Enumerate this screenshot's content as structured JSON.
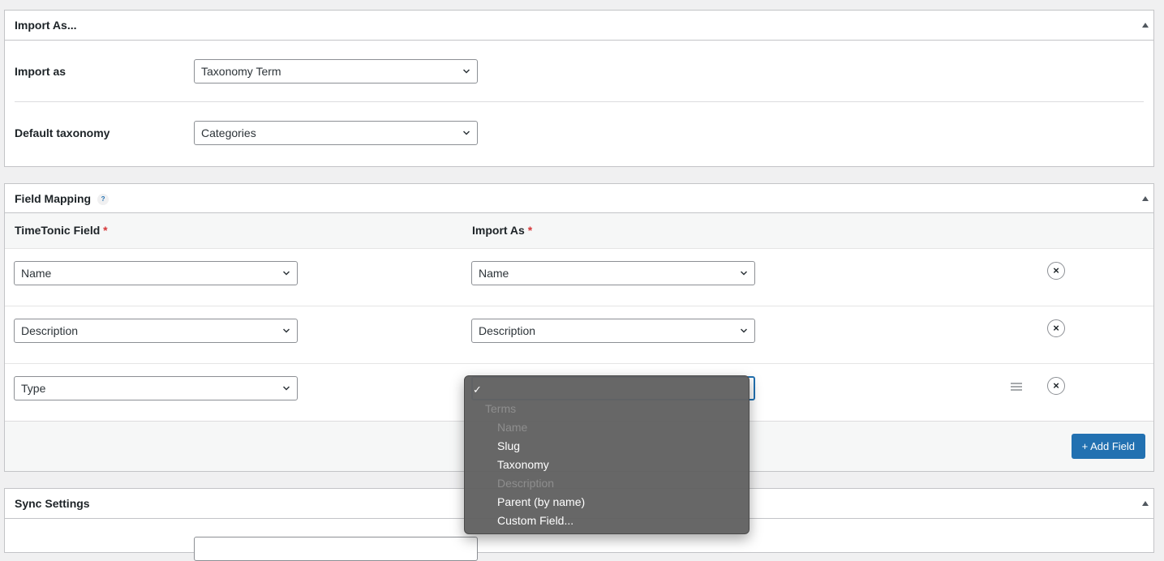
{
  "import_panel": {
    "title": "Import As...",
    "import_as_label": "Import as",
    "import_as_value": "Taxonomy Term",
    "default_taxonomy_label": "Default taxonomy",
    "default_taxonomy_value": "Categories"
  },
  "mapping_panel": {
    "title": "Field Mapping",
    "help": "?",
    "col_source": "TimeTonic Field",
    "col_target": "Import As",
    "required_mark": "*",
    "rows": [
      {
        "source": "Name",
        "target": "Name"
      },
      {
        "source": "Description",
        "target": "Description"
      },
      {
        "source": "Type",
        "target": ""
      }
    ],
    "remove_symbol": "×",
    "add_button": "+ Add Field"
  },
  "dropdown": {
    "check": "✓",
    "group_label": "Terms",
    "options": [
      {
        "label": "Name",
        "disabled": true
      },
      {
        "label": "Slug",
        "disabled": false
      },
      {
        "label": "Taxonomy",
        "disabled": false
      },
      {
        "label": "Description",
        "disabled": true
      },
      {
        "label": "Parent (by name)",
        "disabled": false
      },
      {
        "label": "Custom Field...",
        "disabled": false
      }
    ]
  },
  "sync_panel": {
    "title": "Sync Settings"
  },
  "colors": {
    "accent": "#2271b1",
    "required": "#d63638",
    "dropdown_bg": "#626262"
  }
}
